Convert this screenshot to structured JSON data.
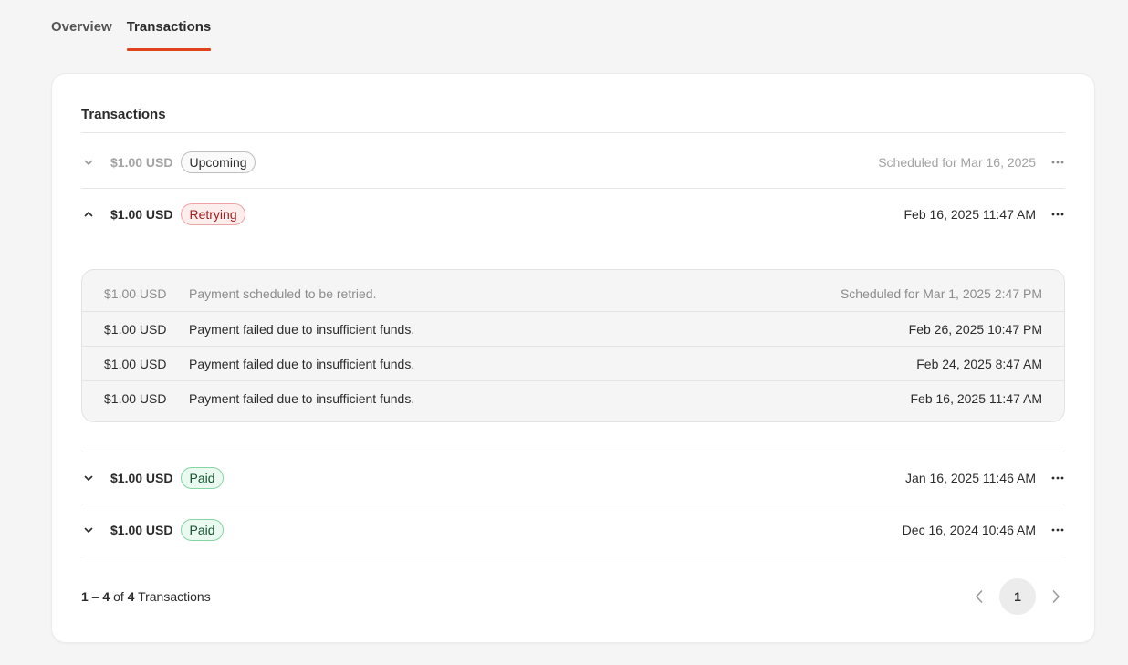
{
  "tabs": [
    {
      "label": "Overview"
    },
    {
      "label": "Transactions"
    }
  ],
  "card": {
    "title": "Transactions"
  },
  "transactions": [
    {
      "amount": "$1.00 USD",
      "status": "Upcoming",
      "date": "Scheduled for Mar 16, 2025"
    },
    {
      "amount": "$1.00 USD",
      "status": "Retrying",
      "date": "Feb 16, 2025 11:47 AM"
    },
    {
      "amount": "$1.00 USD",
      "status": "Paid",
      "date": "Jan 16, 2025 11:46 AM"
    },
    {
      "amount": "$1.00 USD",
      "status": "Paid",
      "date": "Dec 16, 2024 10:46 AM"
    }
  ],
  "attempts": [
    {
      "amount": "$1.00 USD",
      "message": "Payment scheduled to be retried.",
      "date": "Scheduled for Mar 1, 2025 2:47 PM"
    },
    {
      "amount": "$1.00 USD",
      "message": "Payment failed due to insufficient funds.",
      "date": "Feb 26, 2025 10:47 PM"
    },
    {
      "amount": "$1.00 USD",
      "message": "Payment failed due to insufficient funds.",
      "date": "Feb 24, 2025 8:47 AM"
    },
    {
      "amount": "$1.00 USD",
      "message": "Payment failed due to insufficient funds.",
      "date": "Feb 16, 2025 11:47 AM"
    }
  ],
  "footer": {
    "range_start": "1",
    "dash": "–",
    "range_end": "4",
    "of": "of",
    "total": "4",
    "noun": "Transactions",
    "current_page": "1"
  },
  "colors": {
    "accent": "#e0421b",
    "retrying": "#a11e1e",
    "paid": "#14532d"
  },
  "icons": {
    "expand": "chevron-down-icon",
    "collapse": "chevron-up-icon",
    "more": "ellipsis-icon",
    "prev": "chevron-left-icon",
    "next": "chevron-right-icon"
  }
}
